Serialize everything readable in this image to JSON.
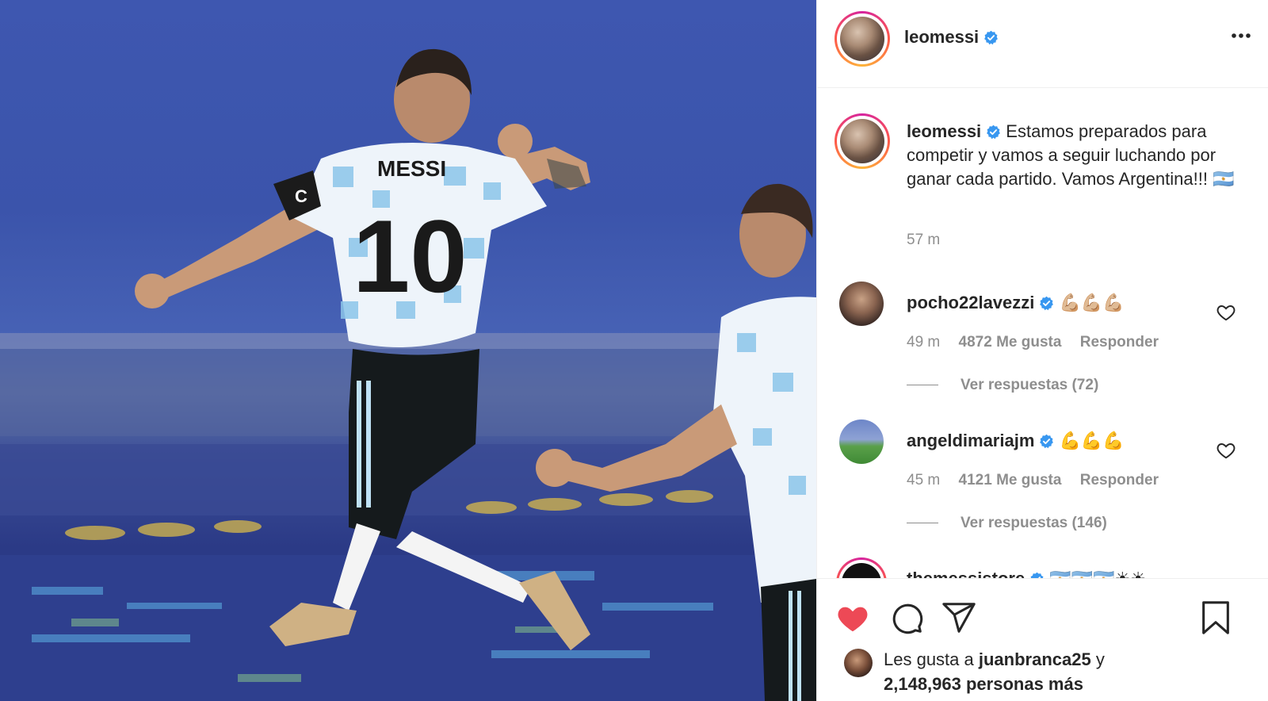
{
  "post": {
    "jersey_name": "MESSI",
    "jersey_number": "10",
    "armband_letter": "C"
  },
  "header": {
    "username": "leomessi",
    "more_icon": "more-horizontal-icon"
  },
  "caption": {
    "username": "leomessi",
    "text": "Estamos preparados para competir y vamos a seguir luchando por ganar cada partido. Vamos Argentina!!! 🇦🇷",
    "time": "57 m"
  },
  "comments": [
    {
      "username": "pocho22lavezzi",
      "text": "💪🏼💪🏼💪🏼",
      "time": "49 m",
      "likes": "4872 Me gusta",
      "reply": "Responder",
      "view_replies": "Ver respuestas (72)"
    },
    {
      "username": "angeldimariajm",
      "text": "💪💪💪",
      "time": "45 m",
      "likes": "4121 Me gusta",
      "reply": "Responder",
      "view_replies": "Ver respuestas (146)"
    },
    {
      "username": "themessistore",
      "text": "🇦🇷🇦🇷🇦🇷☀☀"
    }
  ],
  "actions": {
    "like_icon": "heart-filled-icon",
    "comment_icon": "comment-icon",
    "share_icon": "send-icon",
    "save_icon": "bookmark-icon"
  },
  "likes": {
    "prefix": "Les gusta a",
    "user": "juanbranca25",
    "connector": "y",
    "count": "2,148,963 personas más"
  },
  "colors": {
    "verified": "#3897f0",
    "like": "#ed4956",
    "muted": "#8e8e8e",
    "text": "#262626"
  }
}
